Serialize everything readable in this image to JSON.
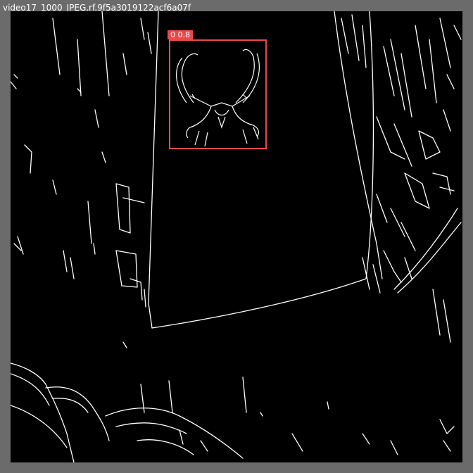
{
  "window": {
    "title": "video17_1000_JPEG.rf.9f5a3019122acf6a07f"
  },
  "image": {
    "description_icon": "edge-detection-image",
    "background_color": "#000000",
    "edge_color": "#ffffff"
  },
  "detection": {
    "label": "0 0.8",
    "box_color": "#e84a4a"
  }
}
